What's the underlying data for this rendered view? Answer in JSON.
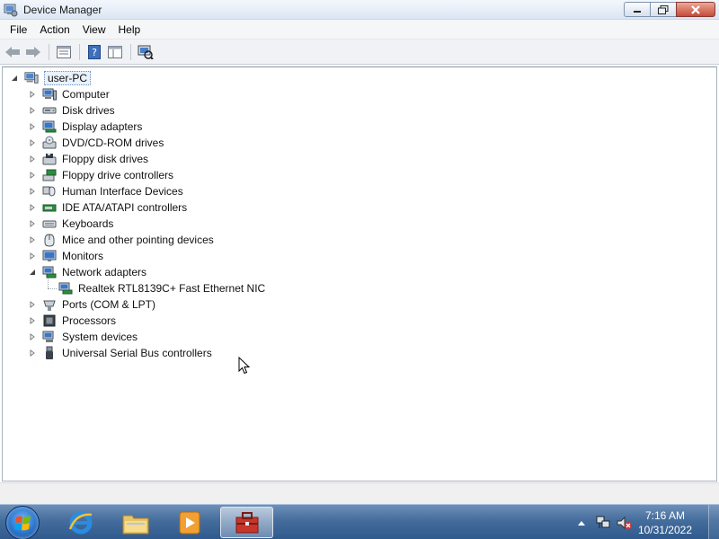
{
  "window": {
    "title": "Device Manager"
  },
  "menu": [
    "File",
    "Action",
    "View",
    "Help"
  ],
  "toolbar": {
    "buttons": [
      "back-icon",
      "forward-icon",
      "properties-view-icon",
      "help-icon",
      "show-hide-tree-icon",
      "scan-hardware-icon"
    ]
  },
  "tree": {
    "root": "user-PC",
    "categories": [
      {
        "label": "Computer",
        "icon": "computer-icon",
        "expanded": false
      },
      {
        "label": "Disk drives",
        "icon": "disk-drive-icon",
        "expanded": false
      },
      {
        "label": "Display adapters",
        "icon": "display-adapter-icon",
        "expanded": false
      },
      {
        "label": "DVD/CD-ROM drives",
        "icon": "dvd-drive-icon",
        "expanded": false
      },
      {
        "label": "Floppy disk drives",
        "icon": "floppy-disk-icon",
        "expanded": false
      },
      {
        "label": "Floppy drive controllers",
        "icon": "floppy-controller-icon",
        "expanded": false
      },
      {
        "label": "Human Interface Devices",
        "icon": "hid-icon",
        "expanded": false
      },
      {
        "label": "IDE ATA/ATAPI controllers",
        "icon": "ide-controller-icon",
        "expanded": false
      },
      {
        "label": "Keyboards",
        "icon": "keyboard-icon",
        "expanded": false
      },
      {
        "label": "Mice and other pointing devices",
        "icon": "mouse-icon",
        "expanded": false
      },
      {
        "label": "Monitors",
        "icon": "monitor-icon",
        "expanded": false
      },
      {
        "label": "Network adapters",
        "icon": "network-adapter-icon",
        "expanded": true,
        "children": [
          {
            "label": "Realtek RTL8139C+ Fast Ethernet NIC",
            "icon": "network-card-icon"
          }
        ]
      },
      {
        "label": "Ports (COM & LPT)",
        "icon": "port-icon",
        "expanded": false
      },
      {
        "label": "Processors",
        "icon": "processor-icon",
        "expanded": false
      },
      {
        "label": "System devices",
        "icon": "system-device-icon",
        "expanded": false
      },
      {
        "label": "Universal Serial Bus controllers",
        "icon": "usb-icon",
        "expanded": false
      }
    ]
  },
  "taskbar": {
    "pinned": [
      "internet-explorer-icon",
      "windows-explorer-icon",
      "media-player-icon",
      "device-manager-task-icon"
    ],
    "clock": {
      "time": "7:16 AM",
      "date": "10/31/2022"
    }
  },
  "colors": {
    "taskbar": "#3f6797",
    "selection": "#e9f1fb",
    "titlebar": "#dbe6f3"
  }
}
